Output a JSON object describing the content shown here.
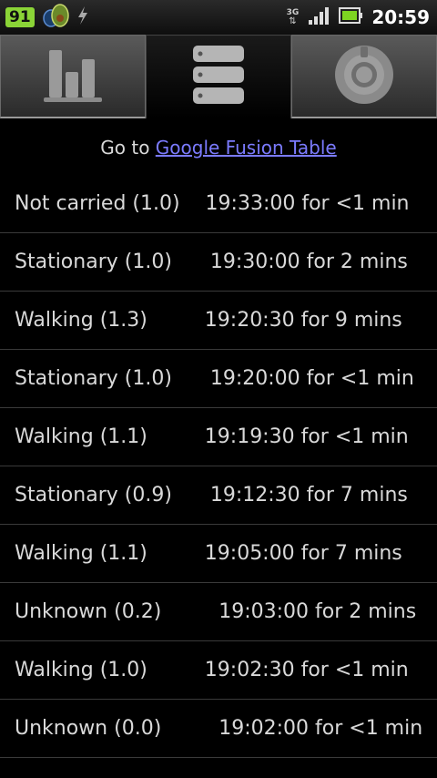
{
  "status_bar": {
    "battery_level": "91",
    "network_type": "3G",
    "time": "20:59",
    "icons": [
      "battery-badge",
      "avocado-app-icon",
      "usb-debug-icon",
      "3g-icon",
      "signal-icon",
      "battery-icon"
    ]
  },
  "tabs": [
    {
      "icon": "bar-chart-icon",
      "selected": false
    },
    {
      "icon": "list-stack-icon",
      "selected": true
    },
    {
      "icon": "settings-dial-icon",
      "selected": false
    }
  ],
  "link_line": {
    "prefix": "Go to ",
    "link_text": "Google Fusion Table"
  },
  "activities": [
    {
      "text": "Not carried (1.0)    19:33:00 for <1 min"
    },
    {
      "text": "Stationary (1.0)      19:30:00 for 2 mins"
    },
    {
      "text": "Walking (1.3)         19:20:30 for 9 mins"
    },
    {
      "text": "Stationary (1.0)      19:20:00 for <1 min"
    },
    {
      "text": "Walking (1.1)         19:19:30 for <1 min"
    },
    {
      "text": "Stationary (0.9)      19:12:30 for 7 mins"
    },
    {
      "text": "Walking (1.1)         19:05:00 for 7 mins"
    },
    {
      "text": "Unknown (0.2)         19:03:00 for 2 mins"
    },
    {
      "text": "Walking (1.0)         19:02:30 for <1 min"
    },
    {
      "text": "Unknown (0.0)         19:02:00 for <1 min"
    }
  ]
}
